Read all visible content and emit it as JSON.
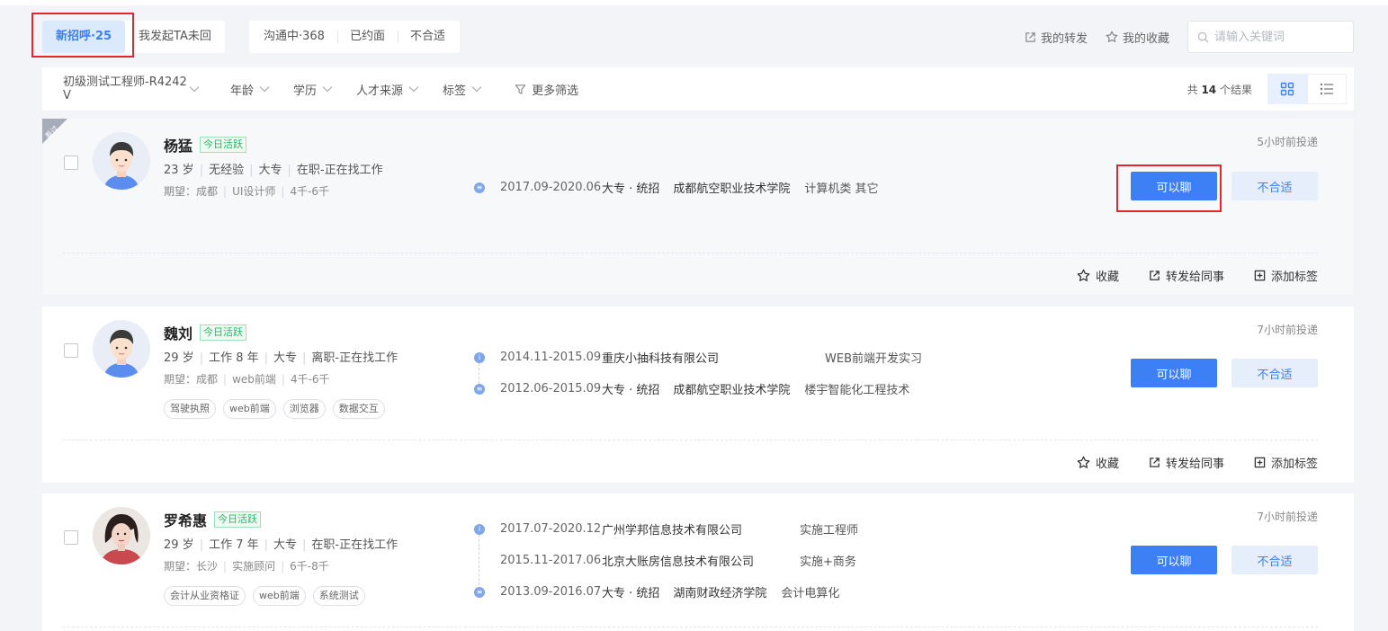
{
  "tabs_primary": [
    {
      "label": "新招呼·25",
      "active": true
    },
    {
      "label": "我发起TA未回",
      "active": false
    }
  ],
  "tabs_status": [
    "沟通中·368",
    "已约面",
    "不合适"
  ],
  "top_links": {
    "forward": "我的转发",
    "favorites": "我的收藏"
  },
  "search": {
    "placeholder": "请输入关键词",
    "value": ""
  },
  "filters": {
    "job": "初级测试工程师-R4242V",
    "items": [
      "年龄",
      "学历",
      "人才来源",
      "标签"
    ],
    "more": "更多筛选"
  },
  "result": {
    "prefix": "共",
    "count": "14",
    "suffix": "个结果"
  },
  "ribbon_text": "看过",
  "actions": {
    "chat": "可以聊",
    "reject": "不合适",
    "fav": "收藏",
    "forward": "转发给同事",
    "tag": "添加标签"
  },
  "badge": "今日活跃",
  "candidates": [
    {
      "name": "杨猛",
      "time": "5小时前投递",
      "info": [
        "23 岁",
        "无经验",
        "大专",
        "在职-正在找工作"
      ],
      "expect_label": "期望：成都",
      "expect": [
        "UI设计师",
        "4千-6千"
      ],
      "tags": [],
      "history": [
        {
          "type": "edu",
          "date": "2017.09-2020.06",
          "org": "大专 · 统招",
          "org2": "成都航空职业技术学院",
          "role": "计算机类 其它"
        }
      ]
    },
    {
      "name": "魏刘",
      "time": "7小时前投递",
      "info": [
        "29 岁",
        "工作 8 年",
        "大专",
        "离职-正在找工作"
      ],
      "expect_label": "期望：成都",
      "expect": [
        "web前端",
        "4千-6千"
      ],
      "tags": [
        "驾驶执照",
        "web前端",
        "浏览器",
        "数据交互"
      ],
      "history": [
        {
          "type": "work",
          "date": "2014.11-2015.09",
          "org": "重庆小抽科技有限公司",
          "role": "WEB前端开发实习"
        },
        {
          "type": "edu",
          "date": "2012.06-2015.09",
          "org": "大专 · 统招",
          "org2": "成都航空职业技术学院",
          "role": "楼宇智能化工程技术"
        }
      ]
    },
    {
      "name": "罗希惠",
      "time": "7小时前投递",
      "info": [
        "29 岁",
        "工作 7 年",
        "大专",
        "在职-正在找工作"
      ],
      "expect_label": "期望：长沙",
      "expect": [
        "实施顾问",
        "6千-8千"
      ],
      "tags": [
        "会计从业资格证",
        "web前端",
        "系统测试"
      ],
      "history": [
        {
          "type": "work",
          "date": "2017.07-2020.12",
          "org": "广州学邦信息技术有限公司",
          "role": "实施工程师"
        },
        {
          "type": "none",
          "date": "2015.11-2017.06",
          "org": "北京大账房信息技术有限公司",
          "role": "实施+商务"
        },
        {
          "type": "edu",
          "date": "2013.09-2016.07",
          "org": "大专 · 统招",
          "org2": "湖南财政经济学院",
          "role": "会计电算化"
        }
      ]
    }
  ],
  "colors": {
    "primary": "#3d7ff5",
    "active_green": "#2fb56a",
    "highlight": "#e6252b"
  }
}
